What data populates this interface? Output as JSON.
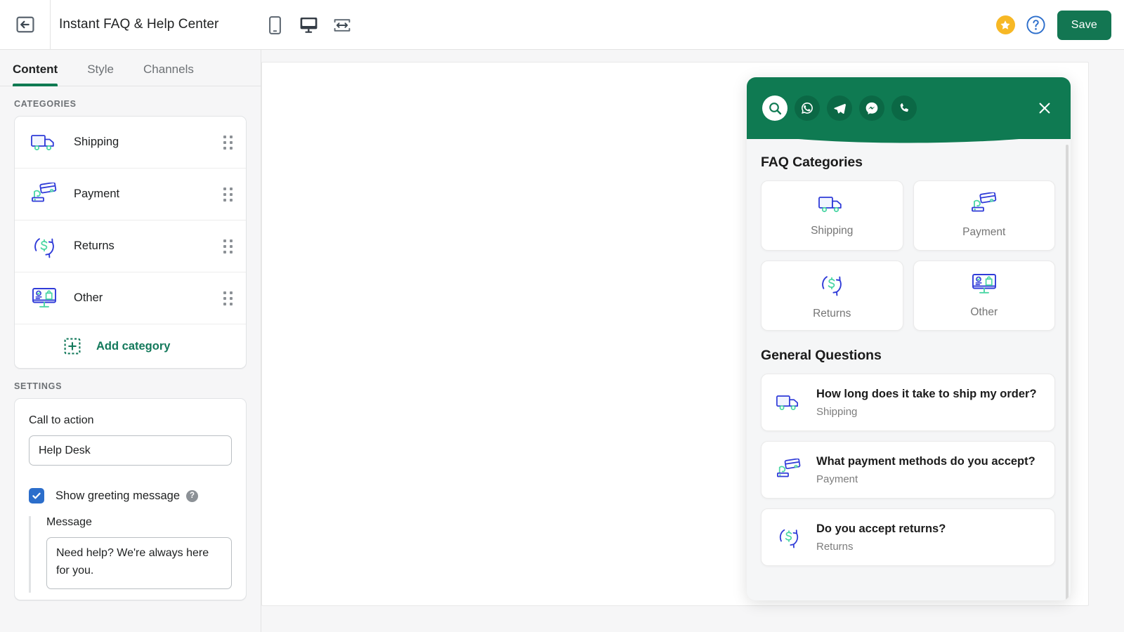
{
  "topbar": {
    "back_icon": "back-arrow-icon",
    "title": "Instant FAQ & Help Center",
    "devices": [
      {
        "name": "mobile",
        "icon": "mobile-icon",
        "active": false
      },
      {
        "name": "desktop",
        "icon": "desktop-icon",
        "active": true
      },
      {
        "name": "fullwidth",
        "icon": "full-width-icon",
        "active": false
      }
    ],
    "star_icon": "star-icon",
    "help_icon": "question-mark-icon",
    "save_label": "Save"
  },
  "sidebar": {
    "tabs": [
      {
        "label": "Content",
        "active": true
      },
      {
        "label": "Style",
        "active": false
      },
      {
        "label": "Channels",
        "active": false
      }
    ],
    "categories_label": "CATEGORIES",
    "categories": [
      {
        "label": "Shipping",
        "icon": "truck-icon"
      },
      {
        "label": "Payment",
        "icon": "credit-card-hand-icon"
      },
      {
        "label": "Returns",
        "icon": "return-dollar-icon"
      },
      {
        "label": "Other",
        "icon": "monitor-bag-icon"
      }
    ],
    "add_category_label": "Add category",
    "add_category_icon": "add-square-icon",
    "settings_label": "SETTINGS",
    "settings": {
      "cta_label": "Call to action",
      "cta_value": "Help Desk",
      "cta_placeholder": "Call to action",
      "greeting_checkbox_label": "Show greeting message",
      "greeting_checked": true,
      "greeting_info_icon": "info-icon",
      "message_label": "Message",
      "message_value": "Need help? We're always here for you.",
      "message_placeholder": "Message"
    }
  },
  "widget": {
    "header": {
      "channels": [
        {
          "name": "search",
          "icon": "search-icon",
          "active": true
        },
        {
          "name": "whatsapp",
          "icon": "whatsapp-icon",
          "active": false
        },
        {
          "name": "telegram",
          "icon": "telegram-icon",
          "active": false
        },
        {
          "name": "messenger",
          "icon": "messenger-icon",
          "active": false
        },
        {
          "name": "phone",
          "icon": "phone-icon",
          "active": false
        }
      ],
      "close_icon": "close-icon",
      "background_color": "#0f7a52"
    },
    "categories_heading": "FAQ Categories",
    "category_tiles": [
      {
        "label": "Shipping",
        "icon": "truck-icon"
      },
      {
        "label": "Payment",
        "icon": "credit-card-hand-icon"
      },
      {
        "label": "Returns",
        "icon": "return-dollar-icon"
      },
      {
        "label": "Other",
        "icon": "monitor-bag-icon"
      }
    ],
    "questions_heading": "General Questions",
    "questions": [
      {
        "title": "How long does it take to ship my order?",
        "category": "Shipping",
        "icon": "truck-icon"
      },
      {
        "title": "What payment methods do you accept?",
        "category": "Payment",
        "icon": "credit-card-hand-icon"
      },
      {
        "title": "Do you accept returns?",
        "category": "Returns",
        "icon": "return-dollar-icon"
      }
    ]
  },
  "colors": {
    "brand_green": "#0f7a52",
    "save_green": "#137652",
    "accent_blue": "#2c6ecb",
    "star_yellow": "#f7b825",
    "icon_blue": "#2f3bd8",
    "icon_teal": "#4ad6a4"
  }
}
